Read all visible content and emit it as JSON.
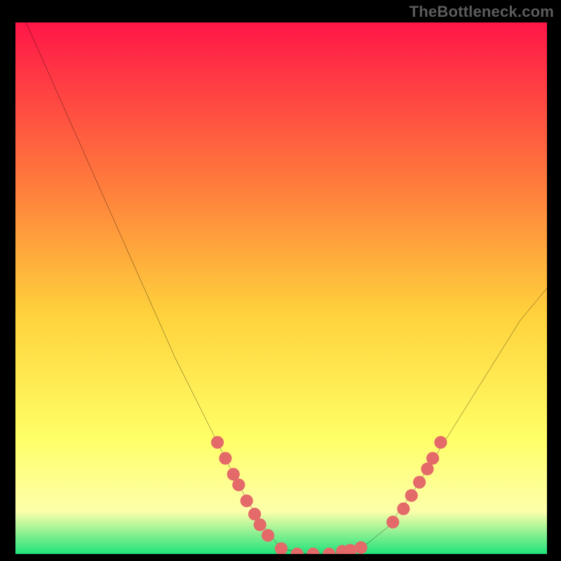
{
  "watermark": {
    "text": "TheBottleneck.com"
  },
  "chart_data": {
    "type": "line",
    "title": "",
    "xlabel": "",
    "ylabel": "",
    "xlim": [
      0,
      100
    ],
    "ylim": [
      0,
      100
    ],
    "grid": false,
    "legend": false,
    "background_gradient": {
      "top": "#ff1648",
      "mid_upper": "#ff7a3c",
      "mid": "#ffd23c",
      "mid_lower": "#ffff66",
      "lower_band": "#fdffaa",
      "bottom": "#20e27a"
    },
    "series": [
      {
        "name": "bottleneck-curve",
        "color": "#000000",
        "x": [
          2,
          6,
          10,
          14,
          18,
          22,
          26,
          30,
          34,
          38,
          42,
          46,
          50,
          55,
          60,
          65,
          70,
          75,
          80,
          85,
          90,
          95,
          100
        ],
        "y": [
          100,
          91,
          82,
          73,
          64,
          55,
          46,
          37,
          29,
          21,
          13,
          6,
          1,
          0,
          0,
          1,
          5,
          12,
          20,
          28,
          36,
          44,
          50
        ]
      }
    ],
    "markers": {
      "name": "highlight-dots",
      "color": "#e46a6a",
      "radius": 1.2,
      "points": [
        {
          "x": 38,
          "y": 21
        },
        {
          "x": 39.5,
          "y": 18
        },
        {
          "x": 41,
          "y": 15
        },
        {
          "x": 42,
          "y": 13
        },
        {
          "x": 43.5,
          "y": 10
        },
        {
          "x": 45,
          "y": 7.5
        },
        {
          "x": 46,
          "y": 5.5
        },
        {
          "x": 47.5,
          "y": 3.5
        },
        {
          "x": 50,
          "y": 1
        },
        {
          "x": 53,
          "y": 0
        },
        {
          "x": 56,
          "y": 0
        },
        {
          "x": 59,
          "y": 0
        },
        {
          "x": 61.5,
          "y": 0.5
        },
        {
          "x": 63,
          "y": 0.7
        },
        {
          "x": 65,
          "y": 1.2
        },
        {
          "x": 71,
          "y": 6
        },
        {
          "x": 73,
          "y": 8.5
        },
        {
          "x": 74.5,
          "y": 11
        },
        {
          "x": 76,
          "y": 13.5
        },
        {
          "x": 77.5,
          "y": 16
        },
        {
          "x": 78.5,
          "y": 18
        },
        {
          "x": 80,
          "y": 21
        }
      ]
    }
  }
}
